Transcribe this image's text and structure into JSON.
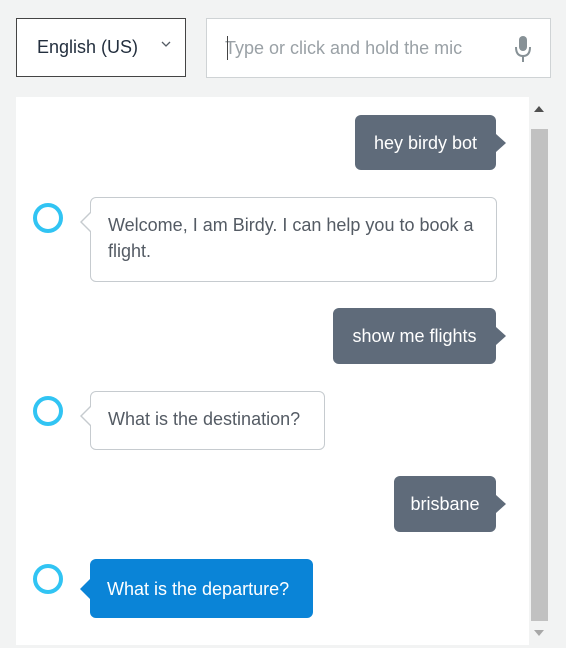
{
  "language": {
    "selected": "English (US)"
  },
  "input": {
    "placeholder": "Type or click and hold the mic",
    "value": ""
  },
  "icons": {
    "dropdown": "chevron-down-icon",
    "mic": "microphone-icon",
    "bot": "alexa-ring-icon"
  },
  "colors": {
    "user_bubble": "#5f6b7a",
    "bot_active": "#0a84d7",
    "bot_ring": "#31c4f3"
  },
  "conversation": [
    {
      "from": "user",
      "text": "hey birdy bot"
    },
    {
      "from": "bot",
      "text": "Welcome, I am Birdy. I can help you to book a flight."
    },
    {
      "from": "user",
      "text": "show me flights"
    },
    {
      "from": "bot",
      "text": "What is the destination?"
    },
    {
      "from": "user",
      "text": "brisbane"
    },
    {
      "from": "bot",
      "text": "What is the departure?",
      "active": true
    }
  ]
}
